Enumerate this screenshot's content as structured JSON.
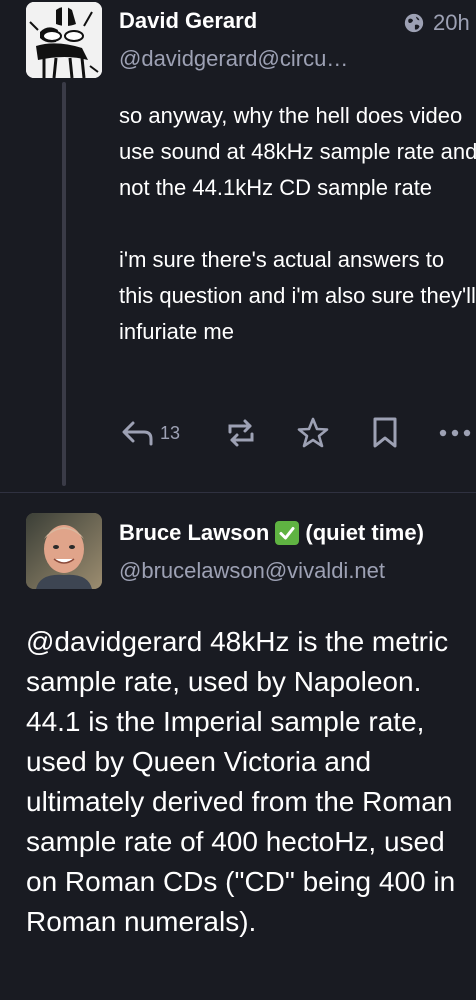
{
  "post1": {
    "display_name": "David Gerard",
    "handle": "@davidgerard@circu…",
    "visibility_icon": "globe-icon",
    "time": "20h",
    "paragraphs": [
      "so anyway, why the hell does video use sound at 48kHz sample rate and not the 44.1kHz CD sample rate",
      "i'm sure there's actual answers to this question and i'm also sure they'll infuriate me"
    ],
    "actions": {
      "reply_icon": "reply-icon",
      "reply_count": "13",
      "boost_icon": "boost-icon",
      "favourite_icon": "star-icon",
      "bookmark_icon": "bookmark-icon",
      "more_icon": "more-icon"
    }
  },
  "post2": {
    "display_name": "Bruce Lawson",
    "badge_emoji": "✅",
    "name_suffix": "(quiet time)",
    "handle": "@brucelawson@vivaldi.net",
    "content": "@davidgerard 48kHz is the metric sample rate, used by Napoleon. 44.1 is the Imperial sample rate, used by Queen Victoria and ultimately derived from the Roman sample rate of 400 hectoHz, used on Roman CDs (\"CD\" being 400 in Roman numerals)."
  },
  "colors": {
    "background": "#191b22",
    "secondary_text": "#9da1b4",
    "thread_line": "#3a3b47",
    "check_badge": "#5fb342"
  }
}
